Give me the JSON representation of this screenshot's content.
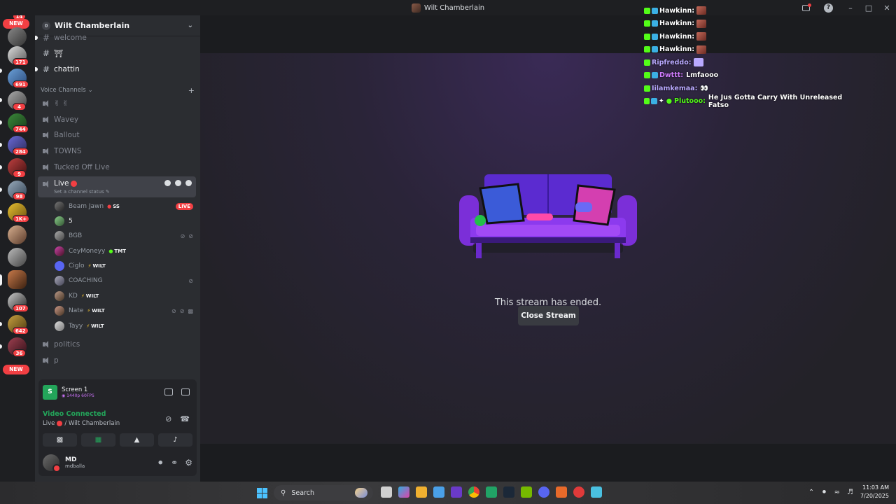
{
  "window": {
    "title": "Wilt Chamberlain"
  },
  "rail": {
    "badges": [
      "14",
      "171",
      "691",
      "4",
      "744",
      "284",
      "9",
      "98",
      "1K+",
      "107",
      "642",
      "36"
    ],
    "new_label_top": "NEW",
    "new_label_bottom": "NEW"
  },
  "guild": {
    "name": "Wilt Chamberlain",
    "boost_count": "0"
  },
  "channels": {
    "text": [
      {
        "name": "welcome"
      },
      {
        "name": "⛩"
      },
      {
        "name": "chattin"
      }
    ],
    "voice_category": "Voice Channels",
    "voice": [
      {
        "name": "✌ ✌"
      },
      {
        "name": "Wavey"
      },
      {
        "name": "Ballout"
      },
      {
        "name": "TOWNS"
      },
      {
        "name": "Tucked Off Live"
      }
    ],
    "live": {
      "name": "Live",
      "status": "Set a channel status ✎"
    },
    "after": [
      {
        "name": "politics"
      },
      {
        "name": "p"
      }
    ]
  },
  "voice_users": [
    {
      "name": "Beam Jawn",
      "tag": "SS",
      "live": "LIVE"
    },
    {
      "name": "5",
      "tag": ""
    },
    {
      "name": "BGB",
      "tag": ""
    },
    {
      "name": "CeyMoneyy",
      "tag": "TMT"
    },
    {
      "name": "Ciglo",
      "tag": "WILT"
    },
    {
      "name": "COACHING",
      "tag": ""
    },
    {
      "name": "KD",
      "tag": "WILT"
    },
    {
      "name": "Nate",
      "tag": "WILT"
    },
    {
      "name": "Tayy",
      "tag": "WILT"
    }
  ],
  "stream_panel": {
    "screen_title": "Screen 1",
    "screen_quality": "◉ 1440p 60FPS",
    "status": "Video Connected",
    "channel": "Live",
    "server": "/ Wilt Chamberlain"
  },
  "user": {
    "display_name": "MD",
    "username": "mdballa"
  },
  "stage": {
    "ended_text": "This stream has ended.",
    "close_button": "Close Stream"
  },
  "chat": [
    {
      "user": "Hawkinn:",
      "color": "#ffffff",
      "msg": ""
    },
    {
      "user": "Hawkinn:",
      "color": "#ffffff",
      "msg": ""
    },
    {
      "user": "Hawkinn:",
      "color": "#ffffff",
      "msg": ""
    },
    {
      "user": "Hawkinn:",
      "color": "#ffffff",
      "msg": ""
    },
    {
      "user": "Ripfreddo:",
      "color": "#b9a9ff",
      "msg": ""
    },
    {
      "user": "Dwttt:",
      "color": "#d07cff",
      "msg": "Lmfaooo"
    },
    {
      "user": "Iilamkemaa:",
      "color": "#b9a9ff",
      "msg": "👀"
    },
    {
      "user": "Plutooo:",
      "color": "#53fc18",
      "msg": "He Jus Gotta Carry With Unreleased Fatso"
    }
  ],
  "taskbar": {
    "search_placeholder": "Search",
    "time": "11:03 AM",
    "date": "7/20/2025"
  },
  "colors": {
    "accent_green": "#23a55a",
    "danger_red": "#f23f43",
    "kick_green": "#53fc18"
  }
}
